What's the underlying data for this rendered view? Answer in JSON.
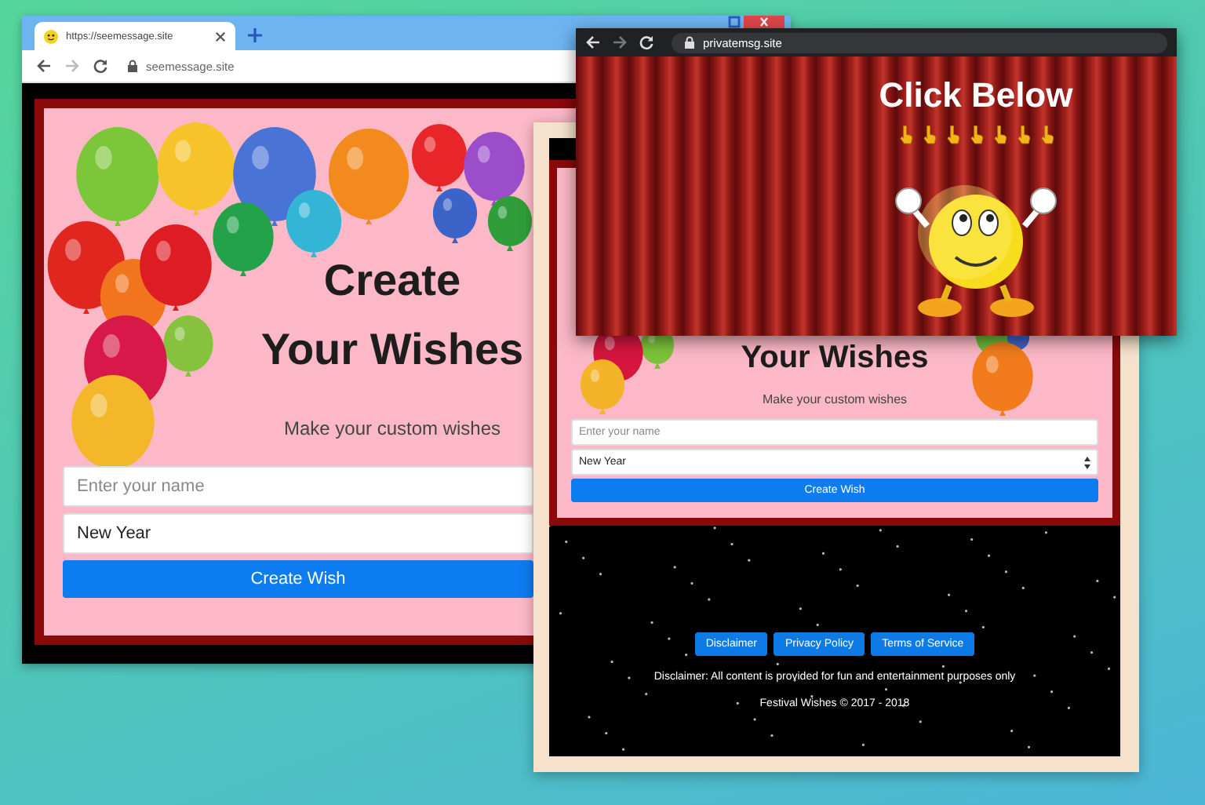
{
  "back_window": {
    "tab": {
      "title": "https://seemessage.site",
      "selected": true
    },
    "address": "seemessage.site",
    "page": {
      "heading": [
        "Create",
        "Your Wishes"
      ],
      "subtitle": "Make your custom wishes",
      "name_field": {
        "placeholder": "Enter your name"
      },
      "occasion_field": {
        "value": "New Year"
      },
      "submit_button": "Create Wish"
    }
  },
  "middle_window": {
    "page": {
      "heading": [
        "Your Wishes"
      ],
      "subtitle": "Make your custom wishes",
      "name_field": {
        "placeholder": "Enter your name"
      },
      "occasion_field": {
        "value": "New Year"
      },
      "submit_button": "Create Wish"
    },
    "footer": {
      "links": [
        "Disclaimer",
        "Privacy Policy",
        "Terms of Service"
      ],
      "disclaimer": "Disclaimer: All content is provided for fun and entertainment purposes only",
      "copyright": "Festival Wishes © 2017 - 2018"
    }
  },
  "front_window": {
    "address": "privatemsg.site",
    "page": {
      "title": "Click Below"
    }
  }
}
